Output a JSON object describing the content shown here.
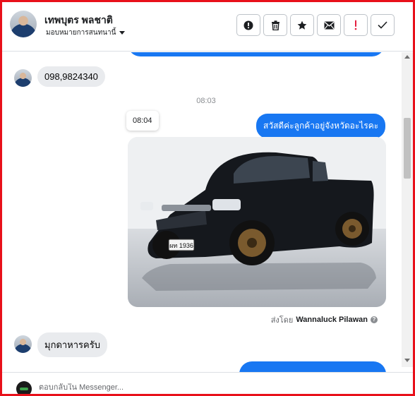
{
  "header": {
    "contact_name": "เทพบุตร พลชาติ",
    "assign_label": "มอบหมายการสนทนานี้"
  },
  "actions": [
    {
      "name": "follow-up-button",
      "icon": "alert-circle-icon"
    },
    {
      "name": "delete-button",
      "icon": "trash-icon"
    },
    {
      "name": "star-button",
      "icon": "star-icon"
    },
    {
      "name": "mark-unread-button",
      "icon": "envelope-icon"
    },
    {
      "name": "spam-button",
      "icon": "exclamation-icon"
    },
    {
      "name": "done-button",
      "icon": "checkmark-icon"
    }
  ],
  "colors": {
    "accent": "#1877f2",
    "frame": "#e8101a",
    "spam": "#e41e3f"
  },
  "messages": {
    "incoming_phone": "098,9824340",
    "time_divider": "08:03",
    "timestamp_tooltip": "08:04",
    "outgoing_question": "สวัสดีค่ะลูกค้าอยู่จังหวัดอะไรคะ",
    "photo": {
      "plate": "ผท 1936",
      "description_icon": "pickup-truck-photo"
    },
    "sent_by_prefix": "ส่งโดย",
    "sent_by_name": "Wannaluck Pilawan",
    "incoming_reply": "มุกดาหารครับ"
  },
  "composer": {
    "placeholder": "ตอบกลับใน Messenger..."
  }
}
